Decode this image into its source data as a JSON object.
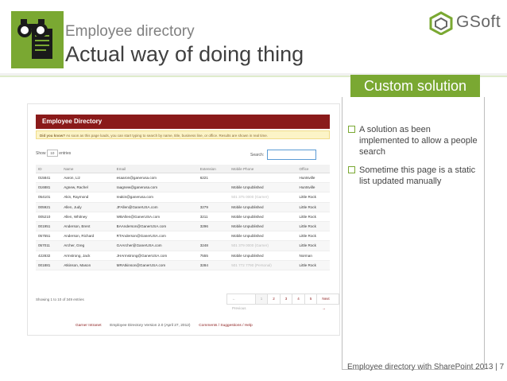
{
  "header": {
    "title_small": "Employee directory",
    "title_big": "Actual way of doing thing",
    "brand": "GSoft",
    "logo_icon": "binoculars-document-icon",
    "accent": "#7aa832"
  },
  "panel": {
    "label": "Custom solution",
    "bullets": [
      "A solution as been implemented to allow a people search",
      "Sometime this page is a static list updated manually"
    ]
  },
  "footer": {
    "text": "Employee directory with SharePoint 2013 | 7"
  },
  "screenshot": {
    "heading": "Employee Directory",
    "tip_label": "Did you know?",
    "tip_text": "As soon as this page loads, you can start typing to search by name, title, business line, or office. Results are shown in real time.",
    "show_label": "Show",
    "show_value": "10",
    "entries_label": "entries",
    "search_label": "Search:",
    "columns": [
      "ID",
      "Name",
      "Email",
      "Extension",
      "Mobile Phone",
      "Office"
    ],
    "rows": [
      [
        "015841",
        "Aaron, Liz",
        "esaaron@ganerusa.com",
        "6221",
        "",
        "Huntsville"
      ],
      [
        "016881",
        "Agnew, Rachel",
        "raagnew@ganerusa.com",
        "",
        "Mobile Unpublished",
        "Huntsville"
      ],
      [
        "054101",
        "Akin, Raymond",
        "reakin@ganerusa.com",
        "",
        "501 375 0000 (Garner)",
        "Little Rock"
      ],
      [
        "005921",
        "Allen, Judy",
        "JFAllen@GanerUSA.com",
        "3279",
        "Mobile Unpublished",
        "Little Rock"
      ],
      [
        "005210",
        "Allen, Whitney",
        "WBAllen@GanerUSA.com",
        "3211",
        "Mobile Unpublished",
        "Little Rock"
      ],
      [
        "001951",
        "Anderson, Brent",
        "BAAnderson@GanerUSA.com",
        "3296",
        "Mobile Unpublished",
        "Little Rock"
      ],
      [
        "057551",
        "Anderson, Richard",
        "RTAnderson@GanerUSA.com",
        "",
        "Mobile Unpublished",
        "Little Rock"
      ],
      [
        "057011",
        "Archer, Greg",
        "GAArcher@GanerUSA.com",
        "3248",
        "501 379 0000 (Garner)",
        "Little Rock"
      ],
      [
        "422832",
        "Armstrong, Jack",
        "JHArmstrong@GanerUSA.com",
        "7555",
        "Mobile Unpublished",
        "Norman"
      ],
      [
        "001881",
        "Atkinson, Mason",
        "MRAtkinson@GanerUSA.com",
        "3284",
        "501 772 7790 (Personal)",
        "Little Rock"
      ]
    ],
    "count_text": "Showing 1 to 10 of 349 entries",
    "pager": [
      "← Previous",
      "1",
      "2",
      "3",
      "4",
      "5",
      "Next →"
    ],
    "foot_left": "Garner Intranet",
    "foot_mid": "Employee Directory Version 2.0 (April 27, 2012)",
    "foot_right": "Comments / Suggestions / Help"
  }
}
